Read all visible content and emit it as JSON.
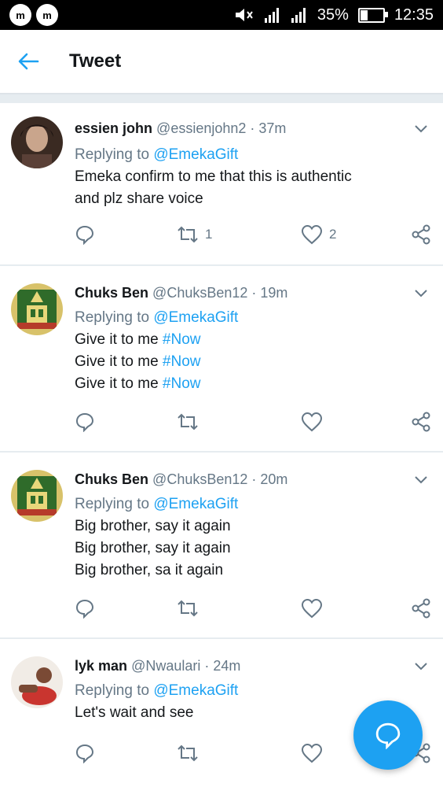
{
  "status_bar": {
    "app_icons": [
      "m",
      "m"
    ],
    "battery": "35%",
    "battery_level": 0.35,
    "time": "12:35"
  },
  "header": {
    "title": "Tweet"
  },
  "tweets": [
    {
      "name": "essien john",
      "handle": "@essienjohn2",
      "time": "37m",
      "replying_prefix": "Replying to ",
      "replying_to": "@EmekaGift",
      "lines": [
        "Emeka confirm to me that this is authentic",
        "and plz share voice"
      ],
      "retweets": "1",
      "likes": "2"
    },
    {
      "name": "Chuks Ben",
      "handle": "@ChuksBen12",
      "time": "19m",
      "replying_prefix": "Replying to ",
      "replying_to": "@EmekaGift",
      "lines": [
        {
          "text": "Give it to me ",
          "tag": "#Now"
        },
        {
          "text": "Give it to me ",
          "tag": "#Now"
        },
        {
          "text": "Give it to me ",
          "tag": "#Now"
        }
      ],
      "retweets": "",
      "likes": ""
    },
    {
      "name": "Chuks Ben",
      "handle": "@ChuksBen12",
      "time": "20m",
      "replying_prefix": "Replying to ",
      "replying_to": "@EmekaGift",
      "lines": [
        "Big brother, say it again",
        "Big brother, say it again",
        "Big brother, sa it again"
      ],
      "retweets": "",
      "likes": ""
    },
    {
      "name": "lyk man",
      "handle": "@Nwaulari",
      "time": "24m",
      "replying_prefix": "Replying to ",
      "replying_to": "@EmekaGift",
      "lines": [
        "Let's wait and see"
      ],
      "retweets": "",
      "likes": ""
    }
  ],
  "separator": " · ",
  "colors": {
    "accent": "#1da1f2",
    "muted": "#657786",
    "divider": "#e6ecf0"
  },
  "icons": [
    "back-arrow-icon",
    "chevron-down-icon",
    "reply-icon",
    "retweet-icon",
    "like-icon",
    "share-icon",
    "compose-reply-icon"
  ]
}
